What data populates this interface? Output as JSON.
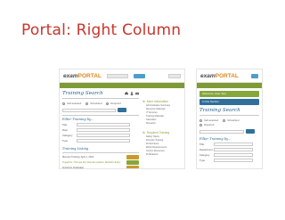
{
  "slide": {
    "title": "Portal: Right Column"
  },
  "portal": {
    "logo_prefix": "exam",
    "logo_brand": "PORTAL",
    "training_search_title": "Training Search",
    "search_radio": [
      "Self-selected",
      "Scheduled",
      "Required"
    ],
    "filter_title": "Filter Training by...",
    "filter_labels": [
      "Title",
      "Dept",
      "Category",
      "Type"
    ],
    "filter_value": "All",
    "training_listing_title": "Training Listing",
    "listing_item": "Moment Training: April 1, 2014",
    "listing_meta": "Organizer: Thomas the Internal Location: Ricardo Library",
    "listing_sub": "Francisco Fridewater",
    "more_info_title": "More Information",
    "more_info_links": [
      "Administrative Summary",
      "Resource Materials",
      "IT Services",
      "Training Materials",
      "Calendars",
      "Research"
    ],
    "required_training_title": "Required Training",
    "required_links": [
      "Safety Topics",
      "Diversity Training",
      "Performance",
      "Ethics Requirements",
      "Course Resources",
      "Publications"
    ]
  },
  "portal_mobile": {
    "welcome_label": "Welcome, User Test",
    "section_label": "In this Section",
    "training_search_title": "Training Search",
    "search_radio": [
      "Self-selected",
      "Scheduled",
      "Required"
    ],
    "filter_title": "Filter Training by...",
    "filter_labels": [
      "Title",
      "Department",
      "Category",
      "Type"
    ],
    "filter_value": "All"
  }
}
